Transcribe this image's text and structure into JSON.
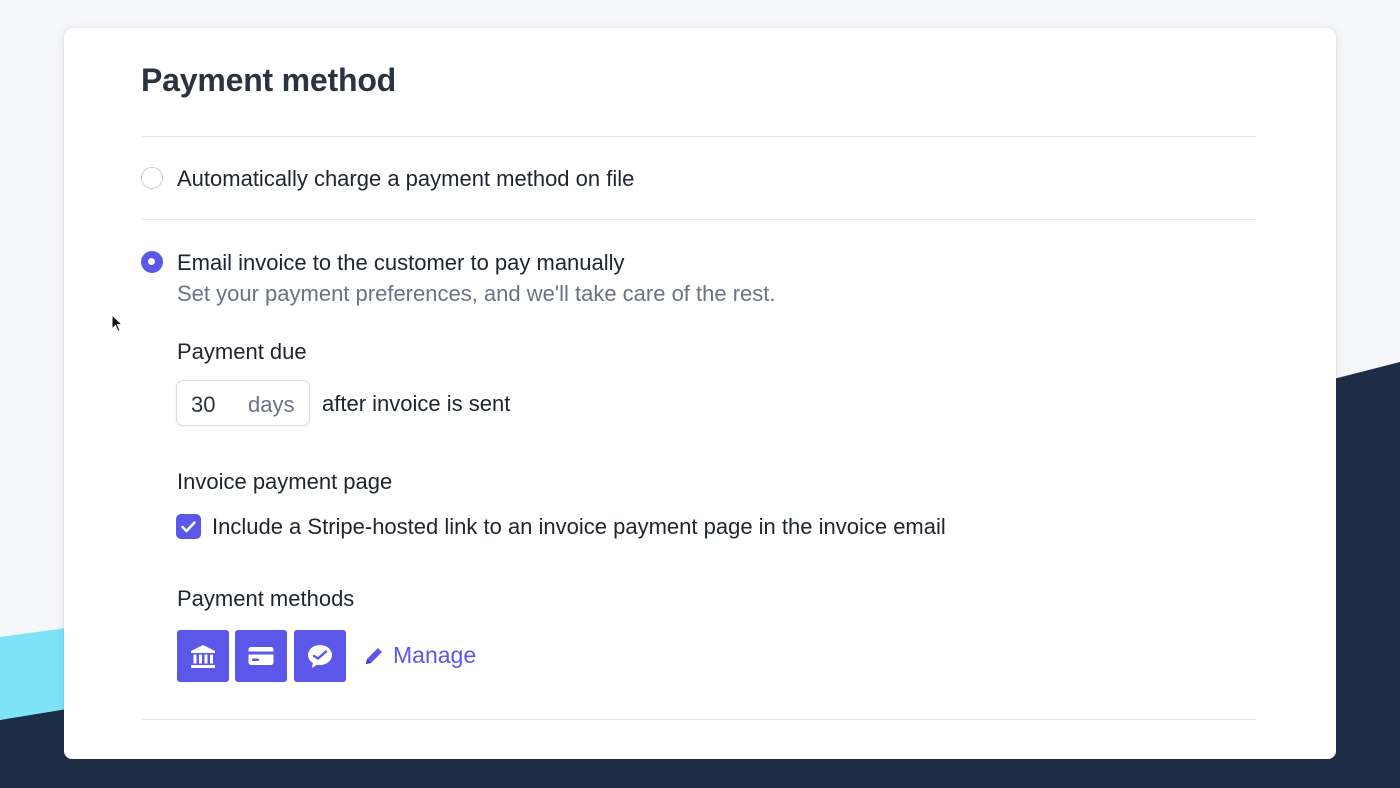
{
  "section": {
    "title": "Payment method"
  },
  "options": {
    "auto_charge": {
      "label": "Automatically charge a payment method on file",
      "selected": false
    },
    "email_invoice": {
      "label": "Email invoice to the customer to pay manually",
      "description": "Set your payment preferences, and we'll take care of the rest.",
      "selected": true
    }
  },
  "payment_due": {
    "label": "Payment due",
    "value": "30",
    "unit": "days",
    "suffix": "after invoice is sent"
  },
  "invoice_page": {
    "label": "Invoice payment page",
    "checkbox_label": "Include a Stripe-hosted link to an invoice payment page in the invoice email",
    "checked": true
  },
  "payment_methods": {
    "label": "Payment methods",
    "icons": [
      "bank-icon",
      "card-icon",
      "wechat-pay-icon"
    ],
    "manage_label": "Manage"
  },
  "colors": {
    "accent": "#5b57e8",
    "navy_background": "#1d2d45",
    "cyan_background": "#7fe3f8"
  }
}
